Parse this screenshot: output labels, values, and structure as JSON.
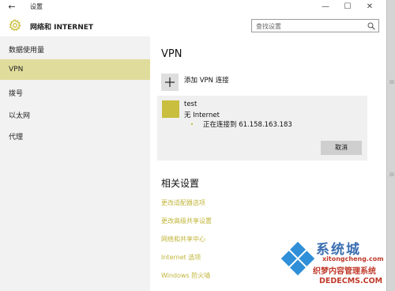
{
  "window": {
    "title": "设置",
    "back_glyph": "←",
    "minimize_glyph": "—",
    "maximize_glyph": "☐",
    "close_glyph": "✕"
  },
  "header": {
    "title": "网络和 INTERNET",
    "icon": "gear-icon",
    "search_placeholder": "查找设置"
  },
  "sidebar": {
    "items": [
      {
        "label": "数据使用量",
        "active": false
      },
      {
        "label": "VPN",
        "active": true
      },
      {
        "label": "拨号",
        "active": false
      },
      {
        "label": "以太网",
        "active": false
      },
      {
        "label": "代理",
        "active": false
      }
    ]
  },
  "main": {
    "heading": "VPN",
    "add_vpn_label": "添加 VPN 连接",
    "vpn": {
      "name": "test",
      "status": "无 Internet",
      "connecting": "正在连接到 61.158.163.183",
      "cancel_label": "取消"
    },
    "related": {
      "heading": "相关设置",
      "links": [
        "更改适配器选项",
        "更改高级共享设置",
        "网络和共享中心",
        "Internet 选项",
        "Windows 防火墙"
      ]
    }
  },
  "watermark": {
    "title": "系统城",
    "url1": "xitongcheng.com",
    "cn": "织梦内容管理系统",
    "url2": "DEDECMS.COM"
  },
  "colors": {
    "accent": "#c9be3d",
    "active_nav": "#e0dd9c",
    "link": "#c0b53a",
    "sidebar_bg": "#f2f2f2"
  }
}
